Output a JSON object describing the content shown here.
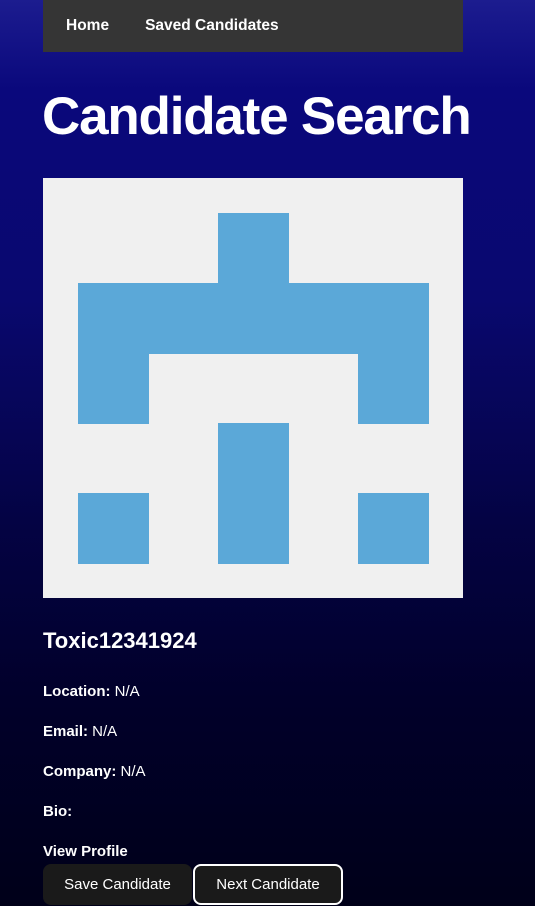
{
  "nav": {
    "home_label": "Home",
    "saved_label": "Saved Candidates"
  },
  "page": {
    "title": "Candidate Search"
  },
  "avatar": {
    "icon": "identicon",
    "background_color": "#f0f0f0",
    "fill_color": "#5ba8d8"
  },
  "candidate": {
    "username": "Toxic12341924",
    "location_label": "Location:",
    "location_value": " N/A",
    "email_label": "Email:",
    "email_value": " N/A",
    "company_label": "Company:",
    "company_value": " N/A",
    "bio_label": "Bio:",
    "bio_value": "",
    "profile_link": "View Profile"
  },
  "actions": {
    "save_label": "Save Candidate",
    "next_label": "Next Candidate"
  },
  "colors": {
    "nav_background": "#353535",
    "page_gradient_top": "#1c1c8f",
    "page_gradient_bottom": "#000019",
    "button_background": "#1a1a1a",
    "text": "#ffffff"
  }
}
